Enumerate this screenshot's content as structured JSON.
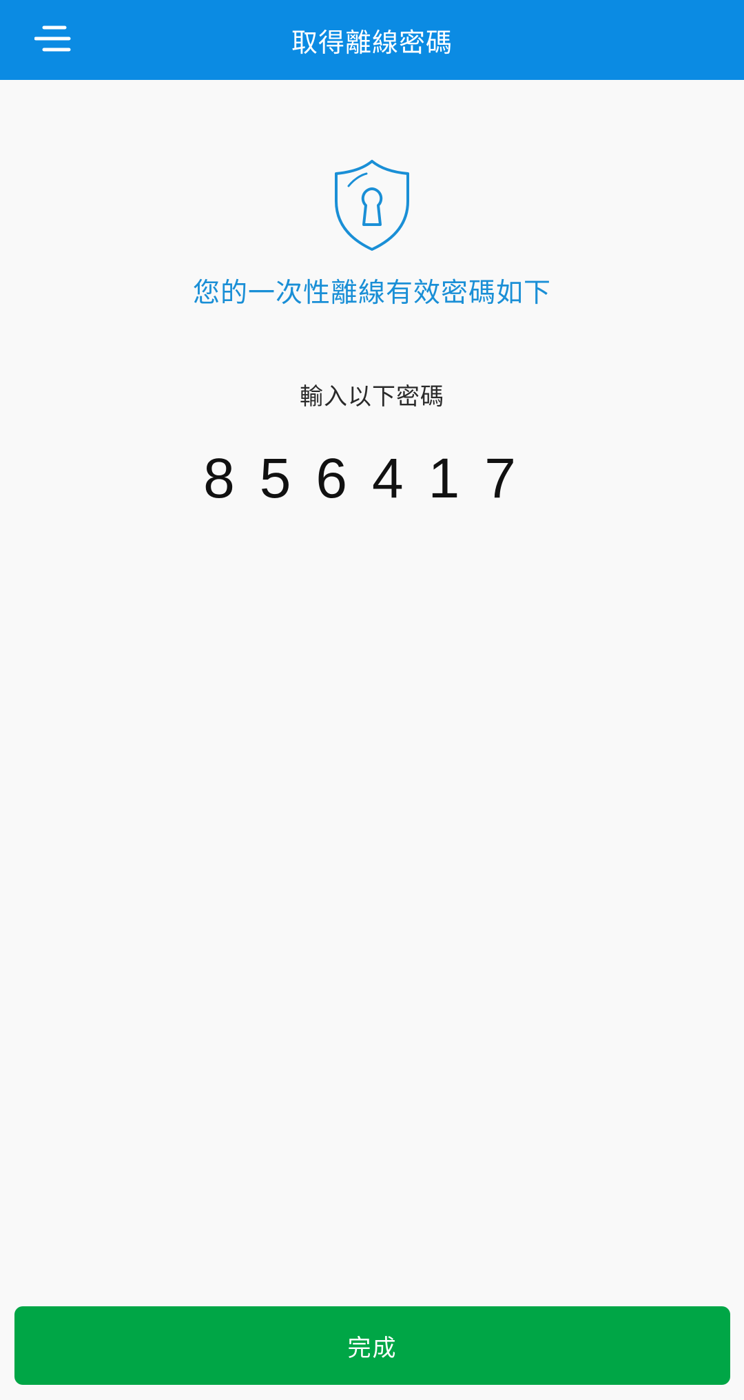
{
  "header": {
    "title": "取得離線密碼",
    "menu_icon": "menu-icon"
  },
  "main": {
    "shield_icon": "shield-keyhole-icon",
    "subtitle": "您的一次性離線有效密碼如下",
    "instruction": "輸入以下密碼",
    "code": "856417"
  },
  "footer": {
    "done_label": "完成"
  },
  "colors": {
    "header_bg": "#0b8be3",
    "accent_text": "#1a8fd6",
    "done_button": "#00a646",
    "background": "#f9f9f9"
  }
}
